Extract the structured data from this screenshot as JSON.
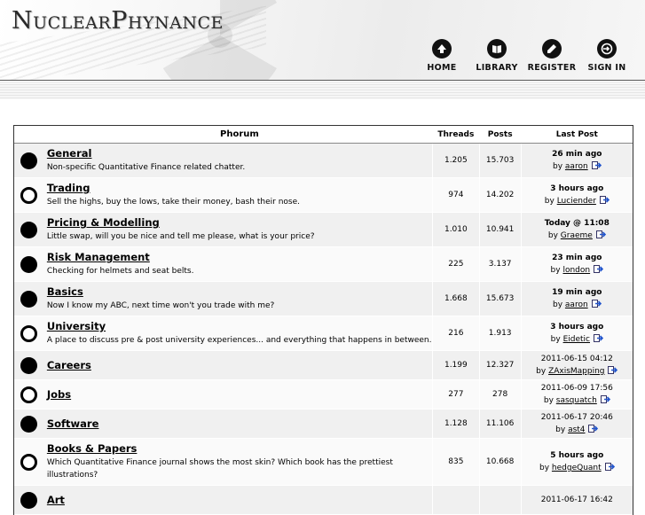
{
  "site": {
    "logo": "NuclearPhynance"
  },
  "nav": [
    {
      "label": "HOME",
      "icon": "up-arrow-icon"
    },
    {
      "label": "LIBRARY",
      "icon": "book-icon"
    },
    {
      "label": "REGISTER",
      "icon": "pencil-icon"
    },
    {
      "label": "SIGN IN",
      "icon": "sign-in-icon"
    }
  ],
  "table": {
    "headers": {
      "phorum": "Phorum",
      "threads": "Threads",
      "posts": "Posts",
      "last_post": "Last Post"
    },
    "forums": [
      {
        "title": "General",
        "description": "Non-specific Quantitative Finance related chatter.",
        "threads": "1.205",
        "posts": "15.703",
        "last_time": "26 min ago",
        "by": "by",
        "user": "aaron",
        "status": "new"
      },
      {
        "title": "Trading",
        "description": "Sell the highs, buy the lows, take their money, bash their nose.",
        "threads": "974",
        "posts": "14.202",
        "last_time": "3 hours ago",
        "by": "by",
        "user": "Luciender",
        "status": "old"
      },
      {
        "title": "Pricing & Modelling",
        "description": "Little swap, will you be nice and tell me please, what is your price?",
        "threads": "1.010",
        "posts": "10.941",
        "last_time": "Today @ 11:08",
        "by": "by",
        "user": "Graeme",
        "status": "new"
      },
      {
        "title": "Risk Management",
        "description": "Checking for helmets and seat belts.",
        "threads": "225",
        "posts": "3.137",
        "last_time": "23 min ago",
        "by": "by",
        "user": "london",
        "status": "new"
      },
      {
        "title": "Basics",
        "description": "Now I know my ABC, next time won't you trade with me?",
        "threads": "1.668",
        "posts": "15.673",
        "last_time": "19 min ago",
        "by": "by",
        "user": "aaron",
        "status": "new"
      },
      {
        "title": "University",
        "description": "A place to discuss pre & post university experiences... and everything that happens in between.",
        "threads": "216",
        "posts": "1.913",
        "last_time": "3 hours ago",
        "by": "by",
        "user": "Eidetic",
        "status": "old"
      },
      {
        "title": "Careers",
        "description": "",
        "threads": "1.199",
        "posts": "12.327",
        "last_time": "2011-06-15 04:12",
        "by": "by",
        "user": "ZAxisMapping",
        "status": "new"
      },
      {
        "title": "Jobs",
        "description": "",
        "threads": "277",
        "posts": "278",
        "last_time": "2011-06-09 17:56",
        "by": "by",
        "user": "sasquatch",
        "status": "old"
      },
      {
        "title": "Software",
        "description": "",
        "threads": "1.128",
        "posts": "11.106",
        "last_time": "2011-06-17 20:46",
        "by": "by",
        "user": "ast4",
        "status": "new"
      },
      {
        "title": "Books & Papers",
        "description": "Which Quantitative Finance journal shows the most skin? Which book has the prettiest illustrations?",
        "threads": "835",
        "posts": "10.668",
        "last_time": "5 hours ago",
        "by": "by",
        "user": "hedgeQuant",
        "status": "old"
      },
      {
        "title": "Art",
        "description": "",
        "threads": "",
        "posts": "",
        "last_time": "2011-06-17 16:42",
        "by": "",
        "user": "",
        "status": "new"
      }
    ]
  }
}
